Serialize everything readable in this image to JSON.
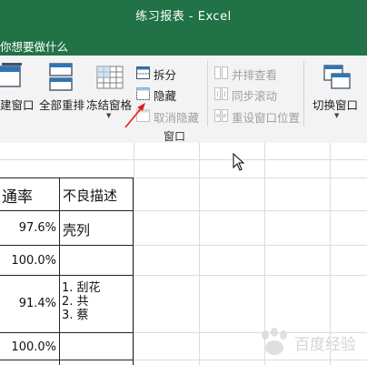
{
  "window": {
    "title": "练习报表 - Excel"
  },
  "tell_me": {
    "placeholder": "你想要做什么"
  },
  "ribbon": {
    "new_window": "建窗口",
    "arrange_all": "全部重排",
    "freeze_panes": "冻结窗格",
    "split": "拆分",
    "hide": "隐藏",
    "unhide": "取消隐藏",
    "view_side_by_side": "并排查看",
    "synchronous_scrolling": "同步滚动",
    "reset_window_position": "重设窗口位置",
    "switch_windows": "切换窗口",
    "group_label": "窗口"
  },
  "sheet": {
    "columns": [
      "通率",
      "不良描述"
    ],
    "rows": [
      {
        "rate": "97.6%",
        "desc": [
          "壳列"
        ]
      },
      {
        "rate": "100.0%",
        "desc": []
      },
      {
        "rate": "91.4%",
        "desc": [
          "1. 刮花",
          "2. 共",
          "3. 蔡"
        ]
      },
      {
        "rate": "100.0%",
        "desc": []
      }
    ]
  },
  "watermark": {
    "text": "百度经验"
  },
  "colors": {
    "excel_green": "#217346",
    "arrow_red": "#e02020"
  }
}
